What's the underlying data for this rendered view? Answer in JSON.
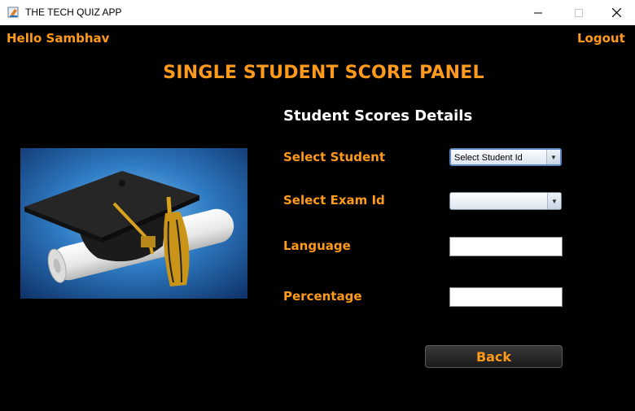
{
  "window": {
    "title": "THE TECH QUIZ APP"
  },
  "header": {
    "greeting": "Hello Sambhav",
    "logout_label": "Logout"
  },
  "panel": {
    "title": "SINGLE STUDENT SCORE PANEL",
    "subtitle": "Student Scores Details"
  },
  "form": {
    "student_label": "Select Student",
    "student_selected": "Select Student Id",
    "exam_label": "Select Exam Id",
    "exam_selected": "",
    "language_label": "Language",
    "language_value": "",
    "percentage_label": "Percentage",
    "percentage_value": ""
  },
  "actions": {
    "back_label": "Back"
  },
  "colors": {
    "accent": "#ff9a1a",
    "background": "#000000"
  },
  "icons": [
    "app-icon",
    "minimize-icon",
    "maximize-icon",
    "close-icon",
    "graduation-cap-image"
  ]
}
